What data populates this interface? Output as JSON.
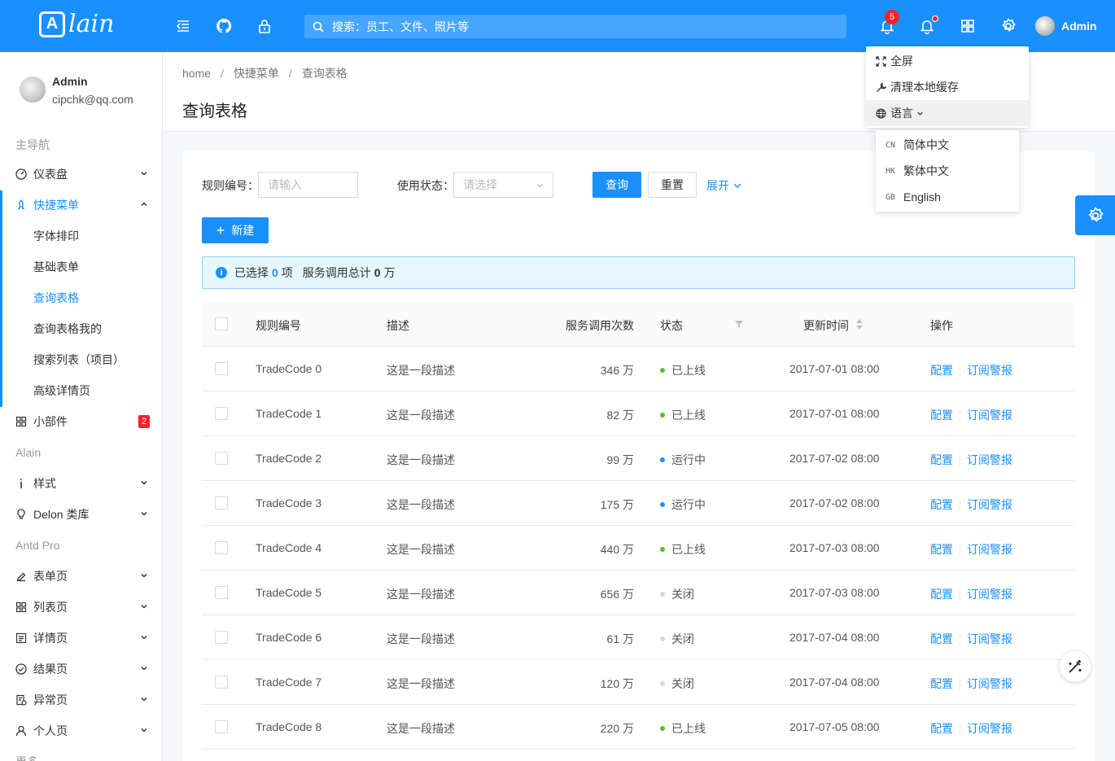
{
  "header": {
    "logo_letter": "A",
    "logo_text": "lain",
    "search_placeholder": "搜索：员工、文件、照片等",
    "notification_count": "5",
    "user_name": "Admin"
  },
  "user_dropdown": {
    "items": [
      {
        "label": "全屏",
        "icon": "fullscreen-icon"
      },
      {
        "label": "清理本地缓存",
        "icon": "tool-icon"
      },
      {
        "label": "语言",
        "icon": "global-icon"
      }
    ],
    "languages": [
      {
        "code": "CN",
        "label": "简体中文"
      },
      {
        "code": "HK",
        "label": "繁体中文"
      },
      {
        "code": "GB",
        "label": "English"
      }
    ]
  },
  "sidebar": {
    "user_name": "Admin",
    "user_email": "cipchk@qq.com",
    "group_main": "主导航",
    "group_alain": "Alain",
    "group_antd": "Antd Pro",
    "group_more": "更多",
    "items": {
      "dashboard": "仪表盘",
      "shortcut": "快捷菜单",
      "widgets": "小部件",
      "widgets_badge": "2",
      "style": "样式",
      "delon": "Delon 类库",
      "form": "表单页",
      "list": "列表页",
      "profile": "详情页",
      "result": "结果页",
      "exception": "异常页",
      "account": "个人页"
    },
    "subitems": [
      "字体排印",
      "基础表单",
      "查询表格",
      "查询表格我的",
      "搜索列表（项目）",
      "高级详情页"
    ]
  },
  "page": {
    "breadcrumb": [
      "home",
      "快捷菜单",
      "查询表格"
    ],
    "title": "查询表格"
  },
  "filter": {
    "rule_label": "规则编号：",
    "rule_placeholder": "请输入",
    "status_label": "使用状态：",
    "status_placeholder": "请选择",
    "query": "查询",
    "reset": "重置",
    "expand": "展开"
  },
  "new_button": "新建",
  "alert": {
    "prefix": "已选择",
    "selected": "0",
    "unit": "项",
    "total_label": "服务调用总计",
    "total": "0",
    "total_unit": "万"
  },
  "table": {
    "columns": [
      "规则编号",
      "描述",
      "服务调用次数",
      "状态",
      "更新时间",
      "操作"
    ],
    "action_config": "配置",
    "action_subscribe": "订阅警报",
    "status_colors": {
      "已上线": "#52c41a",
      "运行中": "#1890ff",
      "关闭": "#d9d9d9"
    },
    "rows": [
      {
        "code": "TradeCode 0",
        "desc": "这是一段描述",
        "calls": "346 万",
        "status": "已上线",
        "updated": "2017-07-01 08:00"
      },
      {
        "code": "TradeCode 1",
        "desc": "这是一段描述",
        "calls": "82 万",
        "status": "已上线",
        "updated": "2017-07-01 08:00"
      },
      {
        "code": "TradeCode 2",
        "desc": "这是一段描述",
        "calls": "99 万",
        "status": "运行中",
        "updated": "2017-07-02 08:00"
      },
      {
        "code": "TradeCode 3",
        "desc": "这是一段描述",
        "calls": "175 万",
        "status": "运行中",
        "updated": "2017-07-02 08:00"
      },
      {
        "code": "TradeCode 4",
        "desc": "这是一段描述",
        "calls": "440 万",
        "status": "已上线",
        "updated": "2017-07-03 08:00"
      },
      {
        "code": "TradeCode 5",
        "desc": "这是一段描述",
        "calls": "656 万",
        "status": "关闭",
        "updated": "2017-07-03 08:00"
      },
      {
        "code": "TradeCode 6",
        "desc": "这是一段描述",
        "calls": "61 万",
        "status": "关闭",
        "updated": "2017-07-04 08:00"
      },
      {
        "code": "TradeCode 7",
        "desc": "这是一段描述",
        "calls": "120 万",
        "status": "关闭",
        "updated": "2017-07-04 08:00"
      },
      {
        "code": "TradeCode 8",
        "desc": "这是一段描述",
        "calls": "220 万",
        "status": "已上线",
        "updated": "2017-07-05 08:00"
      }
    ]
  }
}
